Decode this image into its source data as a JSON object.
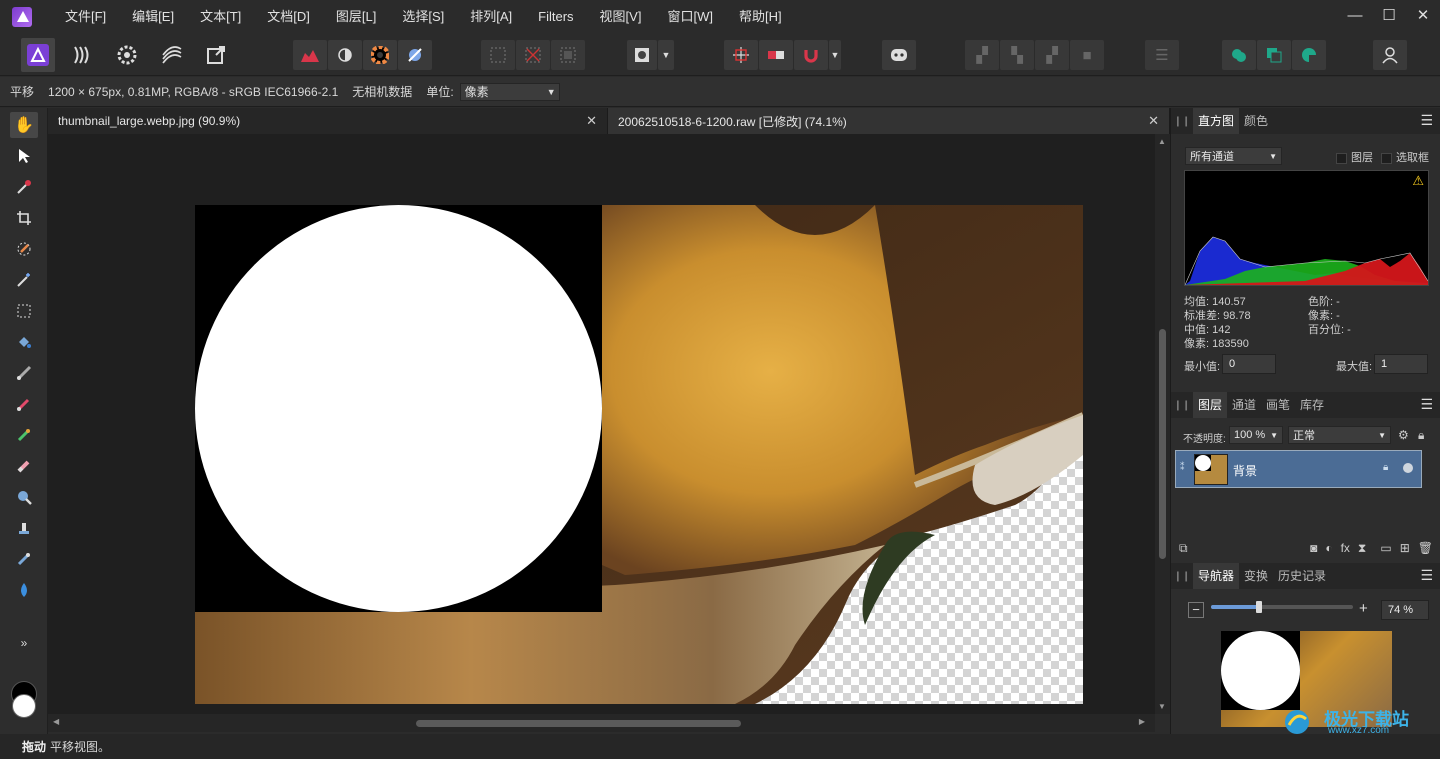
{
  "menu": {
    "items": [
      "文件[F]",
      "编辑[E]",
      "文本[T]",
      "文档[D]",
      "图层[L]",
      "选择[S]",
      "排列[A]",
      "Filters",
      "视图[V]",
      "窗口[W]",
      "帮助[H]"
    ],
    "window_buttons": [
      "—",
      "☐",
      "✕"
    ]
  },
  "context": {
    "tool_name": "平移",
    "image_info": "1200 × 675px, 0.81MP, RGBA/8 - sRGB IEC61966-2.1",
    "camera": "无相机数据",
    "unit_label": "单位:",
    "unit_value": "像素"
  },
  "tabs": [
    {
      "label": "thumbnail_large.webp.jpg (90.9%)",
      "close": "✕"
    },
    {
      "label": "20062510518-6-1200.raw [已修改] (74.1%)",
      "close": "✕"
    }
  ],
  "histogram": {
    "tabs": [
      "直方图",
      "颜色"
    ],
    "channel": "所有通道",
    "layer_check": "图层",
    "selection_check": "选取框",
    "warning": "⚠",
    "stats_left": [
      "均值: 140.57",
      "标准差: 98.78",
      "中值: 142",
      "像素: 183590"
    ],
    "stats_right": [
      "色阶: -",
      "像素: -",
      "百分位: -"
    ],
    "min_label": "最小值:",
    "min_value": "0",
    "max_label": "最大值:",
    "max_value": "1"
  },
  "layers": {
    "tabs": [
      "图层",
      "通道",
      "画笔",
      "库存"
    ],
    "opacity_label": "不透明度:",
    "opacity_value": "100 %",
    "blend_mode": "正常",
    "layer_name": "背景"
  },
  "navigator": {
    "tabs": [
      "导航器",
      "变换",
      "历史记录"
    ],
    "zoom_minus": "−",
    "zoom_plus": "+",
    "zoom_value": "74 %",
    "zoom_level": 0.74
  },
  "status": {
    "action": "拖动",
    "message": "平移视图。"
  },
  "watermark": {
    "text": "极光下载站",
    "url": "www.xz7.com"
  },
  "colors": {
    "accent": "#6d3fd0",
    "selected_layer": "#4b6c95"
  },
  "icons": {
    "tools": [
      "hand-icon",
      "pointer-icon",
      "eyedropper-icon",
      "crop-icon",
      "selection-brush-icon",
      "magic-wand-icon",
      "marquee-icon",
      "flood-fill-icon",
      "paint-brush-icon",
      "pixel-brush-icon",
      "color-replace-icon",
      "eraser-icon",
      "zoom-icon",
      "clone-stamp-icon",
      "healing-icon",
      "blur-icon",
      "more-tools-icon"
    ]
  }
}
